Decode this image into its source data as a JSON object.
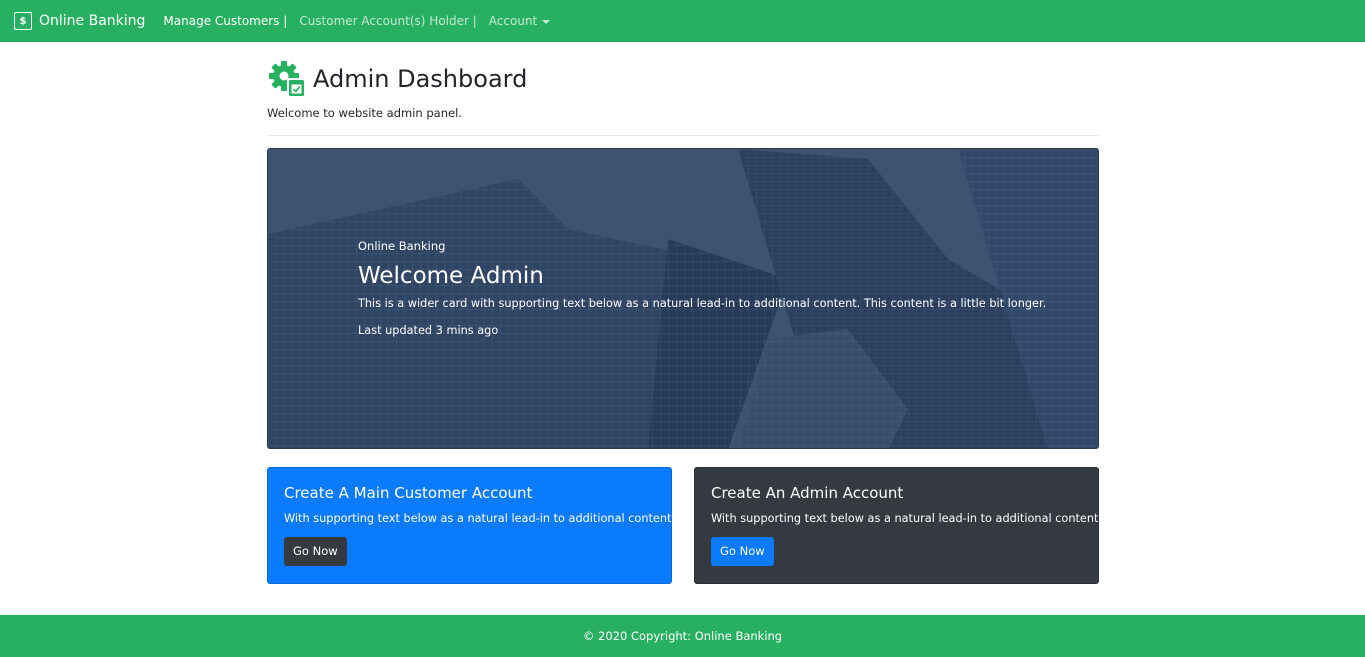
{
  "navbar": {
    "brand": "Online Banking",
    "brand_icon": "dollar-icon",
    "links": [
      {
        "label": "Manage Customers |"
      },
      {
        "label": "Customer Account(s) Holder |"
      },
      {
        "label": "Account"
      }
    ]
  },
  "header": {
    "title": "Admin Dashboard",
    "subtitle": "Welcome to website admin panel.",
    "icon": "gear-check-icon"
  },
  "hero": {
    "label": "Online Banking",
    "title": "Welcome Admin",
    "text": "This is a wider card with supporting text below as a natural lead-in to additional content. This content is a little bit longer.",
    "updated": "Last updated 3 mins ago"
  },
  "cards": [
    {
      "title": "Create A Main Customer Account",
      "text": "With supporting text below as a natural lead-in to additional content.",
      "button": "Go Now"
    },
    {
      "title": "Create An Admin Account",
      "text": "With supporting text below as a natural lead-in to additional content.",
      "button": "Go Now"
    }
  ],
  "footer": {
    "copyright": "© 2020 Copyright: Online Banking"
  },
  "colors": {
    "primary_green": "#28b062",
    "blue": "#0a7bff",
    "dark": "#343a40"
  }
}
